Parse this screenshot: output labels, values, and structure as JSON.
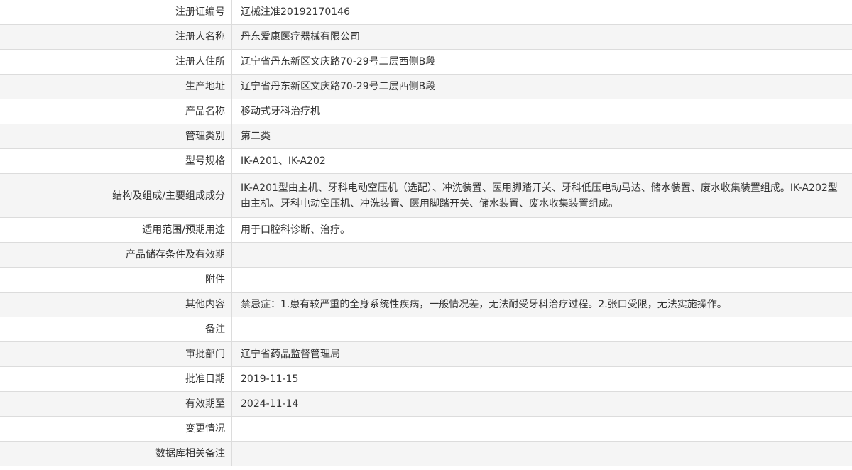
{
  "rows": [
    {
      "label": "注册证编号",
      "value": "辽械注准20192170146"
    },
    {
      "label": "注册人名称",
      "value": "丹东爱康医疗器械有限公司"
    },
    {
      "label": "注册人住所",
      "value": "辽宁省丹东新区文庆路70-29号二层西侧B段"
    },
    {
      "label": "生产地址",
      "value": "辽宁省丹东新区文庆路70-29号二层西侧B段"
    },
    {
      "label": "产品名称",
      "value": "移动式牙科治疗机"
    },
    {
      "label": "管理类别",
      "value": "第二类"
    },
    {
      "label": "型号规格",
      "value": "IK-A201、IK-A202"
    },
    {
      "label": "结构及组成/主要组成成分",
      "value": "IK-A201型由主机、牙科电动空压机（选配）、冲洗装置、医用脚踏开关、牙科低压电动马达、储水装置、废水收集装置组成。IK-A202型由主机、牙科电动空压机、冲洗装置、医用脚踏开关、储水装置、废水收集装置组成。"
    },
    {
      "label": "适用范围/预期用途",
      "value": "用于口腔科诊断、治疗。"
    },
    {
      "label": "产品储存条件及有效期",
      "value": ""
    },
    {
      "label": "附件",
      "value": ""
    },
    {
      "label": "其他内容",
      "value": "禁忌症：1.患有较严重的全身系统性疾病，一般情况差，无法耐受牙科治疗过程。2.张口受限，无法实施操作。"
    },
    {
      "label": "备注",
      "value": ""
    },
    {
      "label": "审批部门",
      "value": "辽宁省药品监督管理局"
    },
    {
      "label": "批准日期",
      "value": "2019-11-15"
    },
    {
      "label": "有效期至",
      "value": "2024-11-14"
    },
    {
      "label": "变更情况",
      "value": ""
    },
    {
      "label": "数据库相关备注",
      "value": ""
    }
  ]
}
